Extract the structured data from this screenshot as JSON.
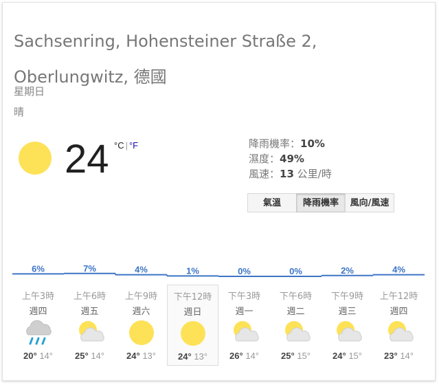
{
  "location": "Sachsenring, Hohensteiner Straße 2, Oberlungwitz, 德國",
  "day": "星期日",
  "condition": "晴",
  "current": {
    "temp": "24",
    "unit_c": "°C",
    "unit_sep": "|",
    "unit_f": "°F",
    "icon": "sunny-icon"
  },
  "details": {
    "precip_label": "降雨機率：",
    "precip_value": "10%",
    "humidity_label": "濕度：",
    "humidity_value": "49%",
    "wind_label": "風速：",
    "wind_value": "13",
    "wind_unit": " 公里/時"
  },
  "tabs": [
    {
      "label": "氣溫"
    },
    {
      "label": "降雨機率"
    },
    {
      "label": "風向/風速"
    }
  ],
  "active_tab": "降雨機率",
  "colors": {
    "accent": "#3c74c6",
    "sun": "#fde257"
  },
  "chart_data": {
    "type": "line",
    "categories": [
      "上午3時",
      "上午6時",
      "上午9時",
      "下午12時",
      "下午3時",
      "下午6時",
      "下午9時",
      "上午12時"
    ],
    "values": [
      6,
      7,
      4,
      1,
      0,
      0,
      2,
      4
    ],
    "labels": [
      "6%",
      "7%",
      "4%",
      "1%",
      "0%",
      "0%",
      "2%",
      "4%"
    ],
    "ylim": [
      0,
      100
    ]
  },
  "forecast": [
    {
      "time": "上午3時",
      "dow": "週四",
      "icon": "rain-cloud-icon",
      "hi": "20°",
      "lo": "14°"
    },
    {
      "time": "上午6時",
      "dow": "週五",
      "icon": "partly-cloudy-icon",
      "hi": "25°",
      "lo": "14°"
    },
    {
      "time": "上午9時",
      "dow": "週六",
      "icon": "sunny-icon",
      "hi": "24°",
      "lo": "13°"
    },
    {
      "time": "下午12時",
      "dow": "週日",
      "icon": "sunny-icon",
      "hi": "24°",
      "lo": "13°"
    },
    {
      "time": "下午3時",
      "dow": "週一",
      "icon": "partly-cloudy-icon",
      "hi": "26°",
      "lo": "14°"
    },
    {
      "time": "下午6時",
      "dow": "週二",
      "icon": "partly-cloudy-icon",
      "hi": "25°",
      "lo": "15°"
    },
    {
      "time": "下午9時",
      "dow": "週三",
      "icon": "partly-cloudy-icon",
      "hi": "24°",
      "lo": "15°"
    },
    {
      "time": "上午12時",
      "dow": "週四",
      "icon": "partly-cloudy-icon",
      "hi": "23°",
      "lo": "14°"
    }
  ],
  "selected_day": "週日"
}
